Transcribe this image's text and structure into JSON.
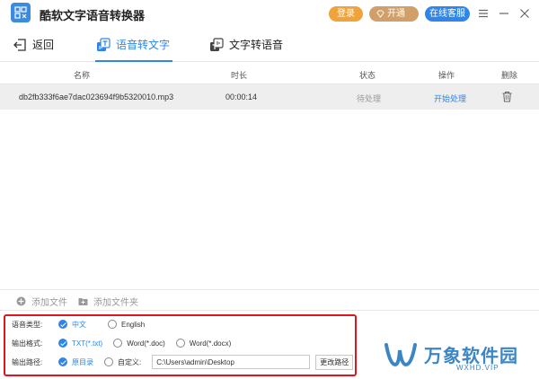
{
  "app": {
    "title": "酷软文字语音转换器"
  },
  "titlebar": {
    "login": "登录",
    "vip": "开通VIP",
    "service": "在线客服"
  },
  "tabs": {
    "back": "返回",
    "speech_to_text": "语音转文字",
    "text_to_speech": "文字转语音"
  },
  "table": {
    "headers": {
      "name": "名称",
      "duration": "时长",
      "status": "状态",
      "action": "操作",
      "delete": "删除"
    },
    "rows": [
      {
        "name": "db2fb333f6ae7dac023694f9b5320010.mp3",
        "duration": "00:00:14",
        "status": "待处理",
        "action": "开始处理"
      }
    ]
  },
  "addbar": {
    "add_file": "添加文件",
    "add_folder": "添加文件夹"
  },
  "options": {
    "lang_label": "语音类型:",
    "lang_options": [
      "中文",
      "English"
    ],
    "lang_selected": "中文",
    "format_label": "输出格式:",
    "format_options": [
      "TXT(*.txt)",
      "Word(*.doc)",
      "Word(*.docx)"
    ],
    "format_selected": "TXT(*.txt)",
    "path_label": "输出路径:",
    "path_options": [
      "原目录",
      "自定义:"
    ],
    "path_selected": "原目录",
    "path_value": "C:\\Users\\admin\\Desktop",
    "change_path": "更改路径"
  },
  "watermark": {
    "text": "万象软件园",
    "sub": "WXHD.VIP"
  },
  "colors": {
    "accent": "#2f86e8",
    "highlight_border": "#e0141e",
    "login": "#f0a33a",
    "vip": "#d1a06a"
  }
}
